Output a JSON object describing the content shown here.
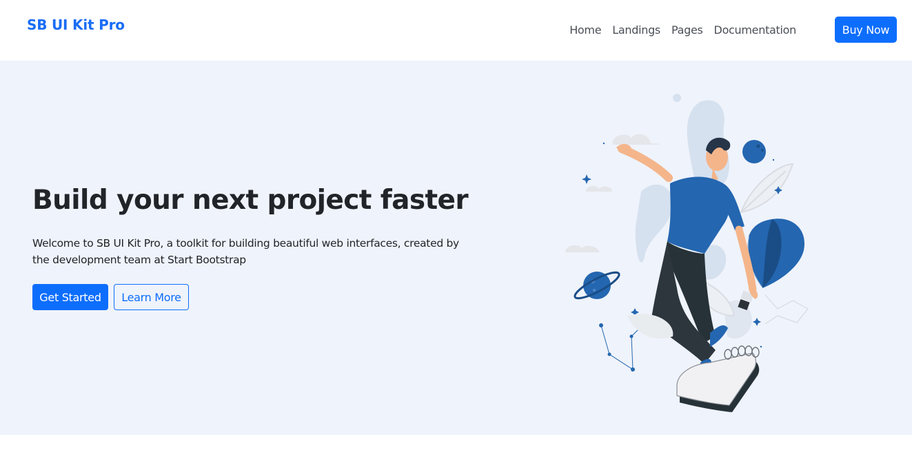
{
  "navbar": {
    "brand": "SB UI Kit Pro",
    "links": [
      "Home",
      "Landings",
      "Pages",
      "Documentation"
    ],
    "cta_label": "Buy Now"
  },
  "hero": {
    "title": "Build your next project faster",
    "lead": "Welcome to SB UI Kit Pro, a toolkit for building beautiful web interfaces, created by the development team at Start Bootstrap",
    "primary_label": "Get Started",
    "secondary_label": "Learn More",
    "illustration": "person-floating-with-hot-air-balloon-lightbulb-illustration"
  },
  "colors": {
    "primary": "#0d6efd",
    "hero_bg": "#eff3fb",
    "illustration_blue": "#2466b0",
    "text_dark": "#212529"
  }
}
